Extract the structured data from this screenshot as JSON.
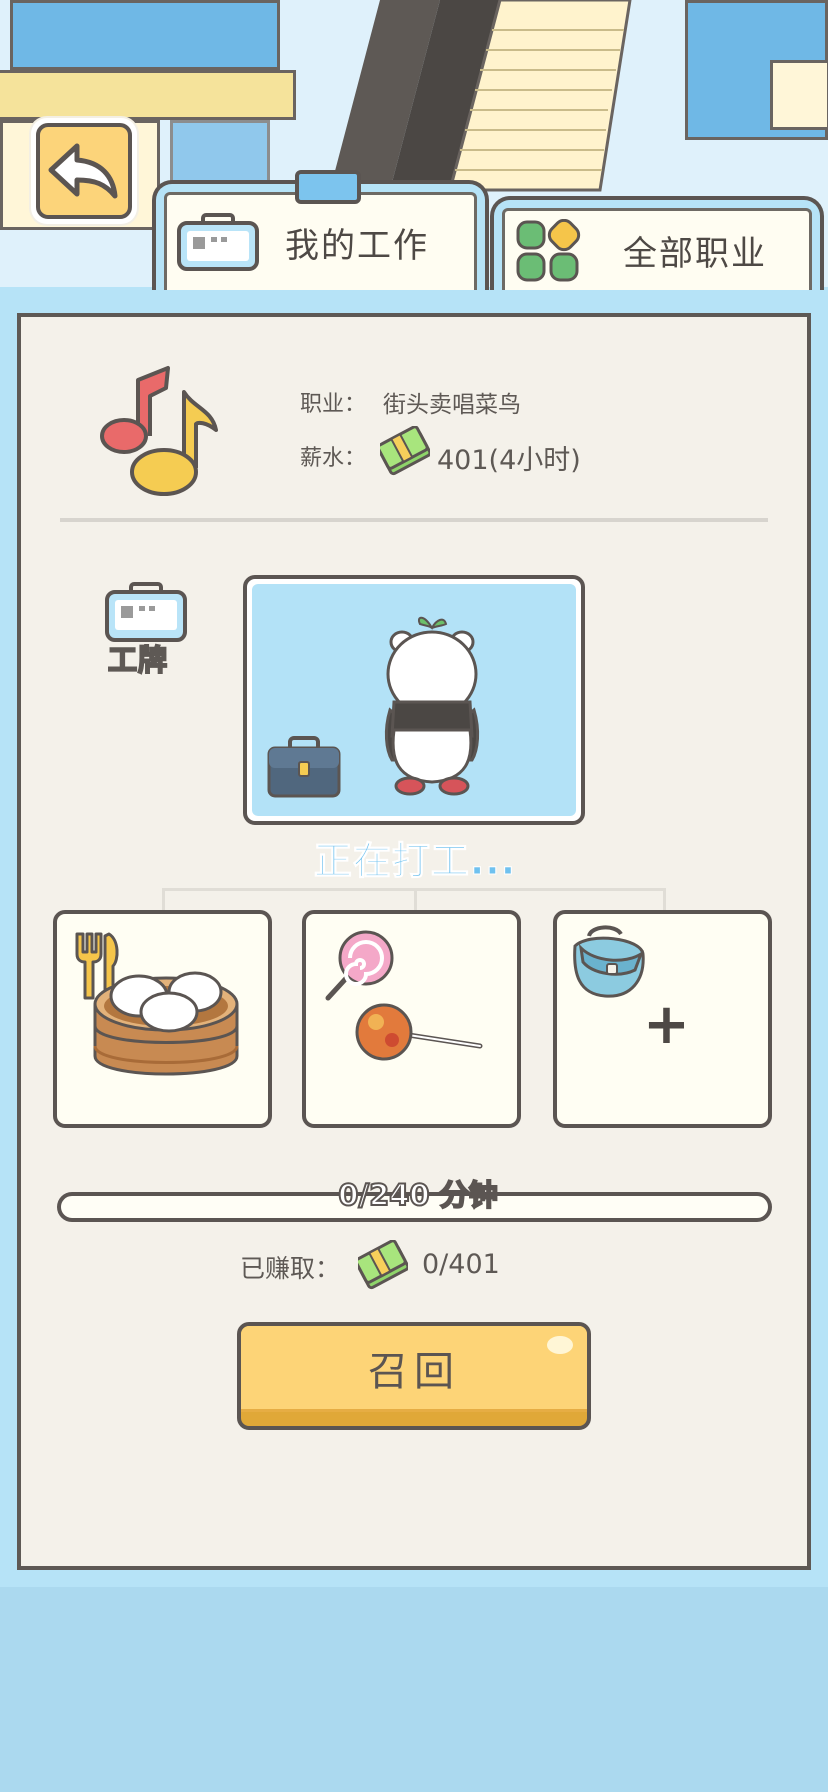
{
  "tabs": [
    {
      "label": "我的工作",
      "icon": "job-badge-icon",
      "active": true
    },
    {
      "label": "全部职业",
      "icon": "grid-icon",
      "active": false
    }
  ],
  "job": {
    "icon": "music-notes-icon",
    "title_label": "职业：",
    "title": "街头卖唱菜鸟",
    "salary_label": "薪水：",
    "salary": "401(4小时)"
  },
  "badge_label": "工牌",
  "status": "正在打工...",
  "slots": [
    {
      "name": "food",
      "icon": "steamed-buns-icon"
    },
    {
      "name": "toy",
      "icon": "candy-apple-icon"
    },
    {
      "name": "bag",
      "icon": "bag-icon",
      "add_symbol": "+"
    }
  ],
  "progress": {
    "label": "0/240 分钟",
    "current": 0,
    "total": 240
  },
  "earned": {
    "label": "已赚取：",
    "value": "0/401"
  },
  "recall_button": "召回",
  "colors": {
    "sky_blue": "#abd9ef",
    "panel": "#f4f1ea",
    "button_yellow": "#fdd477",
    "status_blue": "#6fc1ef",
    "outline": "#5b5552"
  }
}
